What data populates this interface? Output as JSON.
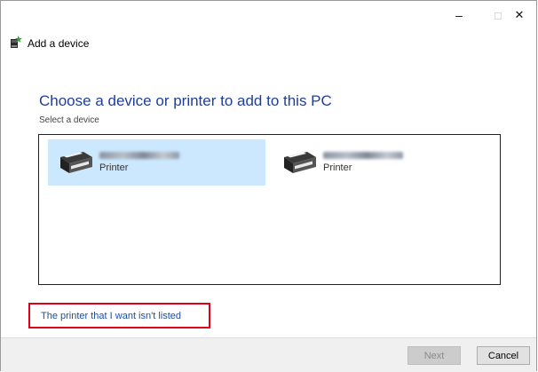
{
  "window": {
    "title": "Add a device",
    "controls": {
      "minimize": "–",
      "maximize": "□",
      "close": "✕"
    }
  },
  "content": {
    "heading": "Choose a device or printer to add to this PC",
    "subheading": "Select a device",
    "devices": [
      {
        "type": "Printer",
        "selected": true
      },
      {
        "type": "Printer",
        "selected": false
      }
    ],
    "missing_link": "The printer that I want isn't listed"
  },
  "footer": {
    "next_label": "Next",
    "cancel_label": "Cancel"
  },
  "colors": {
    "heading": "#1f3e99",
    "link": "#1a4fa3",
    "selection": "#cce8ff",
    "highlight_border": "#e0001b"
  },
  "icons": [
    "printer-add-icon",
    "printer-icon"
  ]
}
